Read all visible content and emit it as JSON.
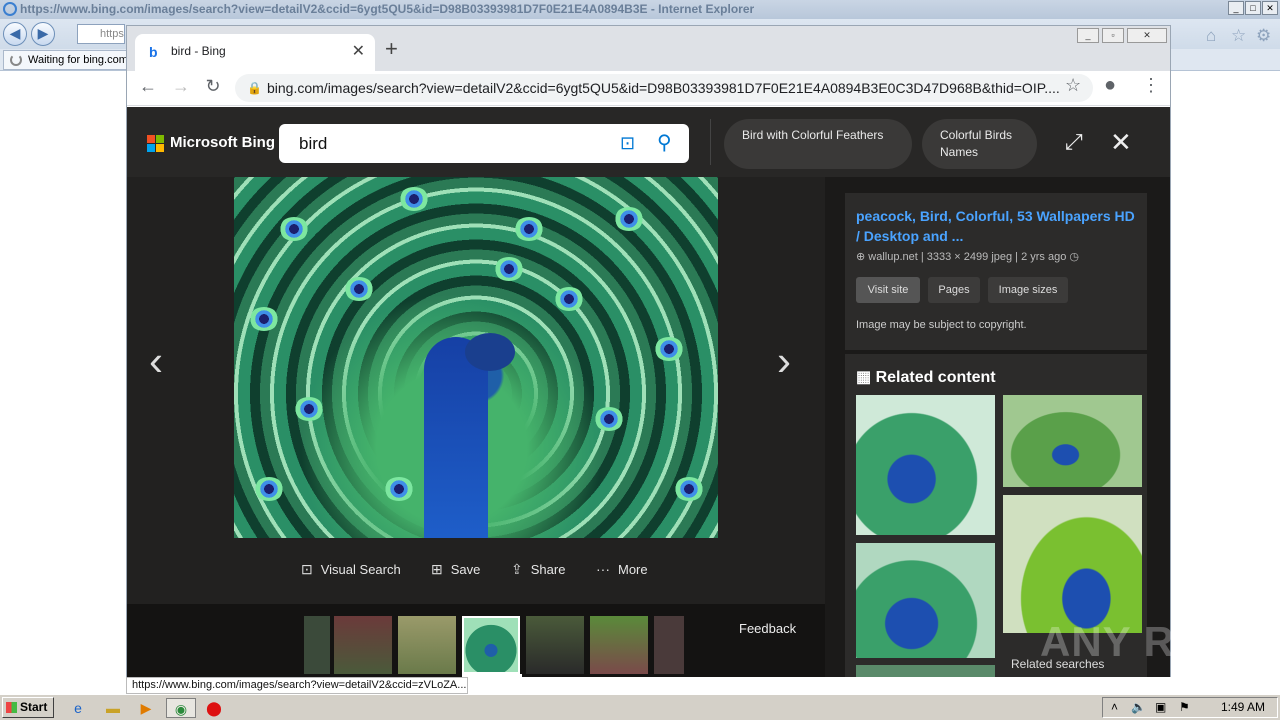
{
  "ie": {
    "title": "https://www.bing.com/images/search?view=detailV2&ccid=6ygt5QU5&id=D98B03393981D7F0E21E4A0894B3E - Internet Explorer",
    "address": "https",
    "tab_label": "Waiting for bing.com",
    "btn_min": "_",
    "btn_max": "□",
    "btn_close": "✕"
  },
  "chrome": {
    "tab_title": "bird - Bing",
    "tab_close": "✕",
    "new_tab": "+",
    "url": "bing.com/images/search?view=detailV2&ccid=6ygt5QU5&id=D98B03393981D7F0E21E4A0894B3E0C3D47D968B&thid=OIP....",
    "back": "←",
    "forward": "→",
    "reload": "↻",
    "star": "☆",
    "profile": "●",
    "menu": "⋮"
  },
  "bing": {
    "brand": "Microsoft Bing",
    "query": "bird",
    "chips": [
      "Bird with Colorful Feathers",
      "Colorful Birds\nNames"
    ],
    "prev": "‹",
    "next": "›",
    "actions": {
      "visual_search": "Visual Search",
      "save": "Save",
      "share": "Share",
      "more": "More"
    },
    "feedback": "Feedback",
    "info": {
      "title": "peacock, Bird, Colorful, 53 Wallpapers HD / Desktop and ...",
      "meta": "wallup.net  |  3333 × 2499 jpeg  |  2 yrs ago",
      "visit": "Visit site",
      "pages": "Pages",
      "sizes": "Image sizes",
      "copyright": "Image may be subject to copyright."
    },
    "related_title": "Related content",
    "related_searches": "Related searches"
  },
  "status_url": "https://www.bing.com/images/search?view=detailV2&ccid=zVLoZA...",
  "taskbar": {
    "start": "Start",
    "time": "1:49 AM"
  },
  "watermark": "ANY RUN"
}
